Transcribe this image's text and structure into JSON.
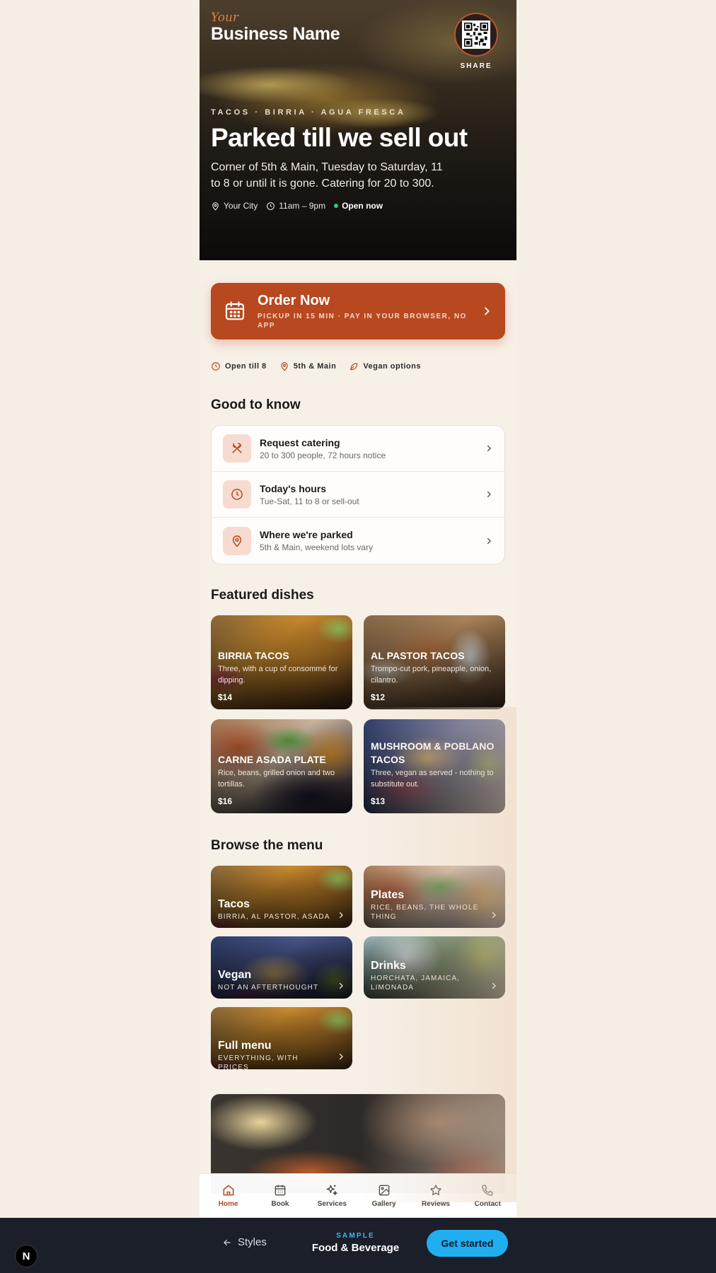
{
  "hero": {
    "brand_your": "Your",
    "brand_name": "Business Name",
    "share_label": "SHARE",
    "tags": "TACOS · BIRRIA · AGUA FRESCA",
    "title": "Parked till we sell out",
    "subtitle": "Corner of 5th & Main, Tuesday to Saturday, 11 to 8 or until it is gone. Catering for 20 to 300.",
    "city": "Your City",
    "hours": "11am – 9pm",
    "status": "Open now"
  },
  "order": {
    "title": "Order Now",
    "subtitle": "PICKUP IN 15 MIN · PAY IN YOUR BROWSER, NO APP"
  },
  "chips": [
    "Open till 8",
    "5th & Main",
    "Vegan options"
  ],
  "good_to_know": {
    "title": "Good to know",
    "items": [
      {
        "title": "Request catering",
        "desc": "20 to 300 people, 72 hours notice",
        "icon": "utensils-icon"
      },
      {
        "title": "Today's hours",
        "desc": "Tue-Sat, 11 to 8 or sell-out",
        "icon": "clock-icon"
      },
      {
        "title": "Where we're parked",
        "desc": "5th & Main, weekend lots vary",
        "icon": "map-pin-icon"
      }
    ]
  },
  "featured": {
    "title": "Featured dishes",
    "items": [
      {
        "name": "BIRRIA TACOS",
        "desc": "Three, with a cup of consommé for dipping.",
        "price": "$14"
      },
      {
        "name": "AL PASTOR TACOS",
        "desc": "Trompo-cut pork, pineapple, onion, cilantro.",
        "price": "$12"
      },
      {
        "name": "CARNE ASADA PLATE",
        "desc": "Rice, beans, grilled onion and two tortillas.",
        "price": "$16"
      },
      {
        "name": "MUSHROOM & POBLANO TACOS",
        "desc": "Three, vegan as served - nothing to substitute out.",
        "price": "$13"
      }
    ]
  },
  "menu": {
    "title": "Browse the menu",
    "items": [
      {
        "name": "Tacos",
        "sub": "BIRRIA, AL PASTOR, ASADA"
      },
      {
        "name": "Plates",
        "sub": "RICE, BEANS, THE WHOLE THING"
      },
      {
        "name": "Vegan",
        "sub": "NOT AN AFTERTHOUGHT"
      },
      {
        "name": "Drinks",
        "sub": "HORCHATA, JAMAICA, LIMONADA"
      },
      {
        "name": "Full menu",
        "sub": "EVERYTHING, WITH PRICES"
      }
    ]
  },
  "tabs": [
    {
      "label": "Home",
      "icon": "home-icon",
      "active": true
    },
    {
      "label": "Book",
      "icon": "calendar-icon"
    },
    {
      "label": "Services",
      "icon": "sparkles-icon"
    },
    {
      "label": "Gallery",
      "icon": "image-icon"
    },
    {
      "label": "Reviews",
      "icon": "star-icon"
    },
    {
      "label": "Contact",
      "icon": "phone-icon"
    }
  ],
  "bottom_bar": {
    "logo": "N",
    "back_label": "Styles",
    "sample_label": "SAMPLE",
    "category": "Food & Beverage",
    "cta": "Get started"
  },
  "colors": {
    "accent": "#b8481f",
    "background": "#f7f0e7",
    "cta_blue": "#21aef0",
    "open_green": "#2fd07a"
  }
}
